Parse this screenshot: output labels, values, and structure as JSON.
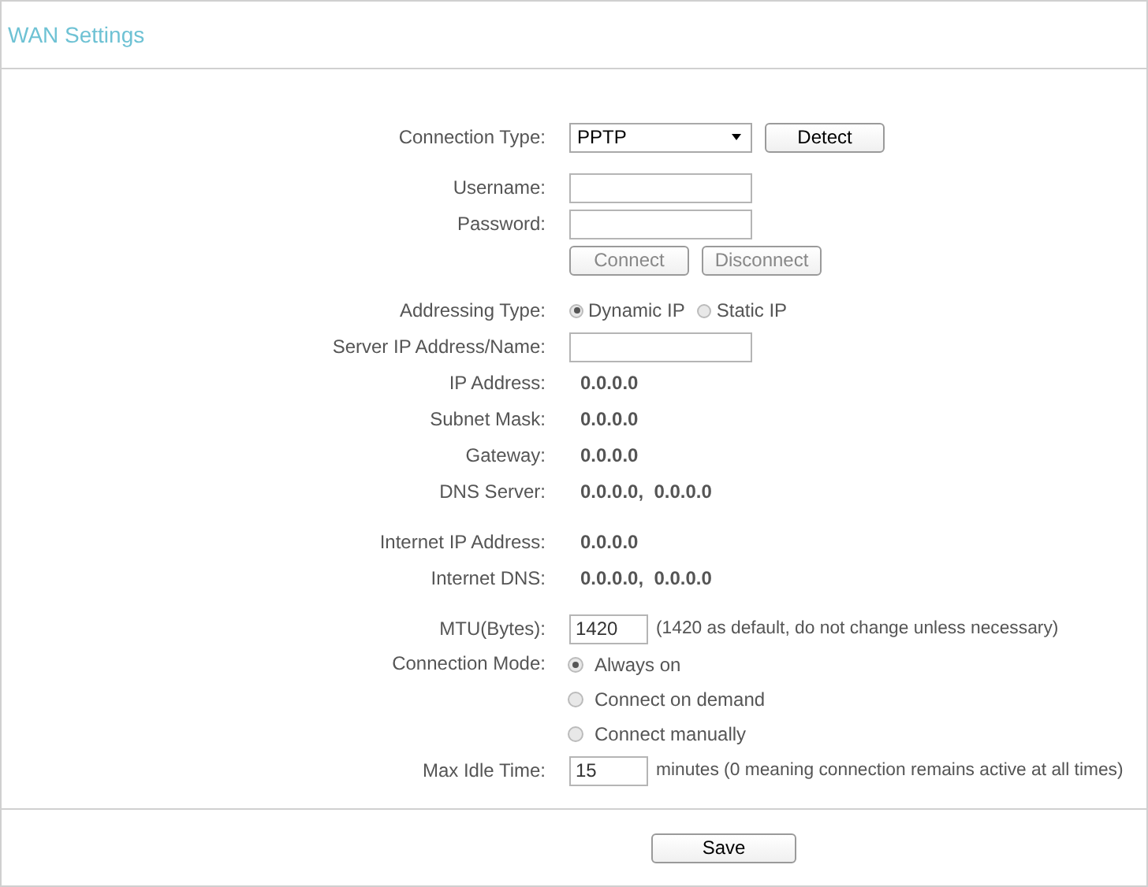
{
  "title": "WAN Settings",
  "sections": [
    {
      "rows": [
        {
          "kind": "select",
          "label": "Connection Type:",
          "value": "PPTP",
          "button": {
            "label": "Detect",
            "disabled": false
          }
        }
      ]
    },
    {
      "rows": [
        {
          "kind": "input",
          "label": "Username:"
        },
        {
          "kind": "input",
          "label": "Password:"
        },
        {
          "kind": "buttons",
          "buttons": [
            {
              "label": "Connect",
              "disabled": true
            },
            {
              "label": "Disconnect",
              "disabled": true
            }
          ]
        }
      ]
    },
    {
      "rows": [
        {
          "kind": "radio",
          "label": "Addressing Type:",
          "options": [
            {
              "label": "Dynamic IP",
              "selected": true
            },
            {
              "label": "Static IP",
              "selected": false
            }
          ]
        },
        {
          "kind": "input",
          "label": "Server IP Address/Name:"
        },
        {
          "kind": "value",
          "label": "IP Address:",
          "value": "0.0.0.0"
        },
        {
          "kind": "value",
          "label": "Subnet Mask:",
          "value": "0.0.0.0"
        },
        {
          "kind": "value",
          "label": "Gateway:",
          "value": "0.0.0.0"
        },
        {
          "kind": "value",
          "label": "DNS Server:",
          "value": "0.0.0.0,  0.0.0.0"
        }
      ]
    },
    {
      "rows": [
        {
          "kind": "value",
          "label": "Internet IP Address:",
          "value": "0.0.0.0"
        },
        {
          "kind": "value",
          "label": "Internet DNS:",
          "value": "0.0.0.0,  0.0.0.0"
        }
      ]
    },
    {
      "rows": [
        {
          "kind": "input",
          "label": "MTU(Bytes):",
          "value": "1420",
          "note": "(1420 as default, do not change unless necessary)"
        },
        {
          "kind": "radio-stack",
          "label": "Connection Mode:",
          "options": [
            {
              "label": "Always on",
              "selected": true
            },
            {
              "label": "Connect on demand",
              "selected": false
            },
            {
              "label": "Connect manually",
              "selected": false
            }
          ]
        },
        {
          "kind": "input",
          "label": "Max Idle Time:",
          "value": "15",
          "note": "minutes (0 meaning connection remains active at all times)"
        }
      ]
    }
  ],
  "save_button": "Save"
}
